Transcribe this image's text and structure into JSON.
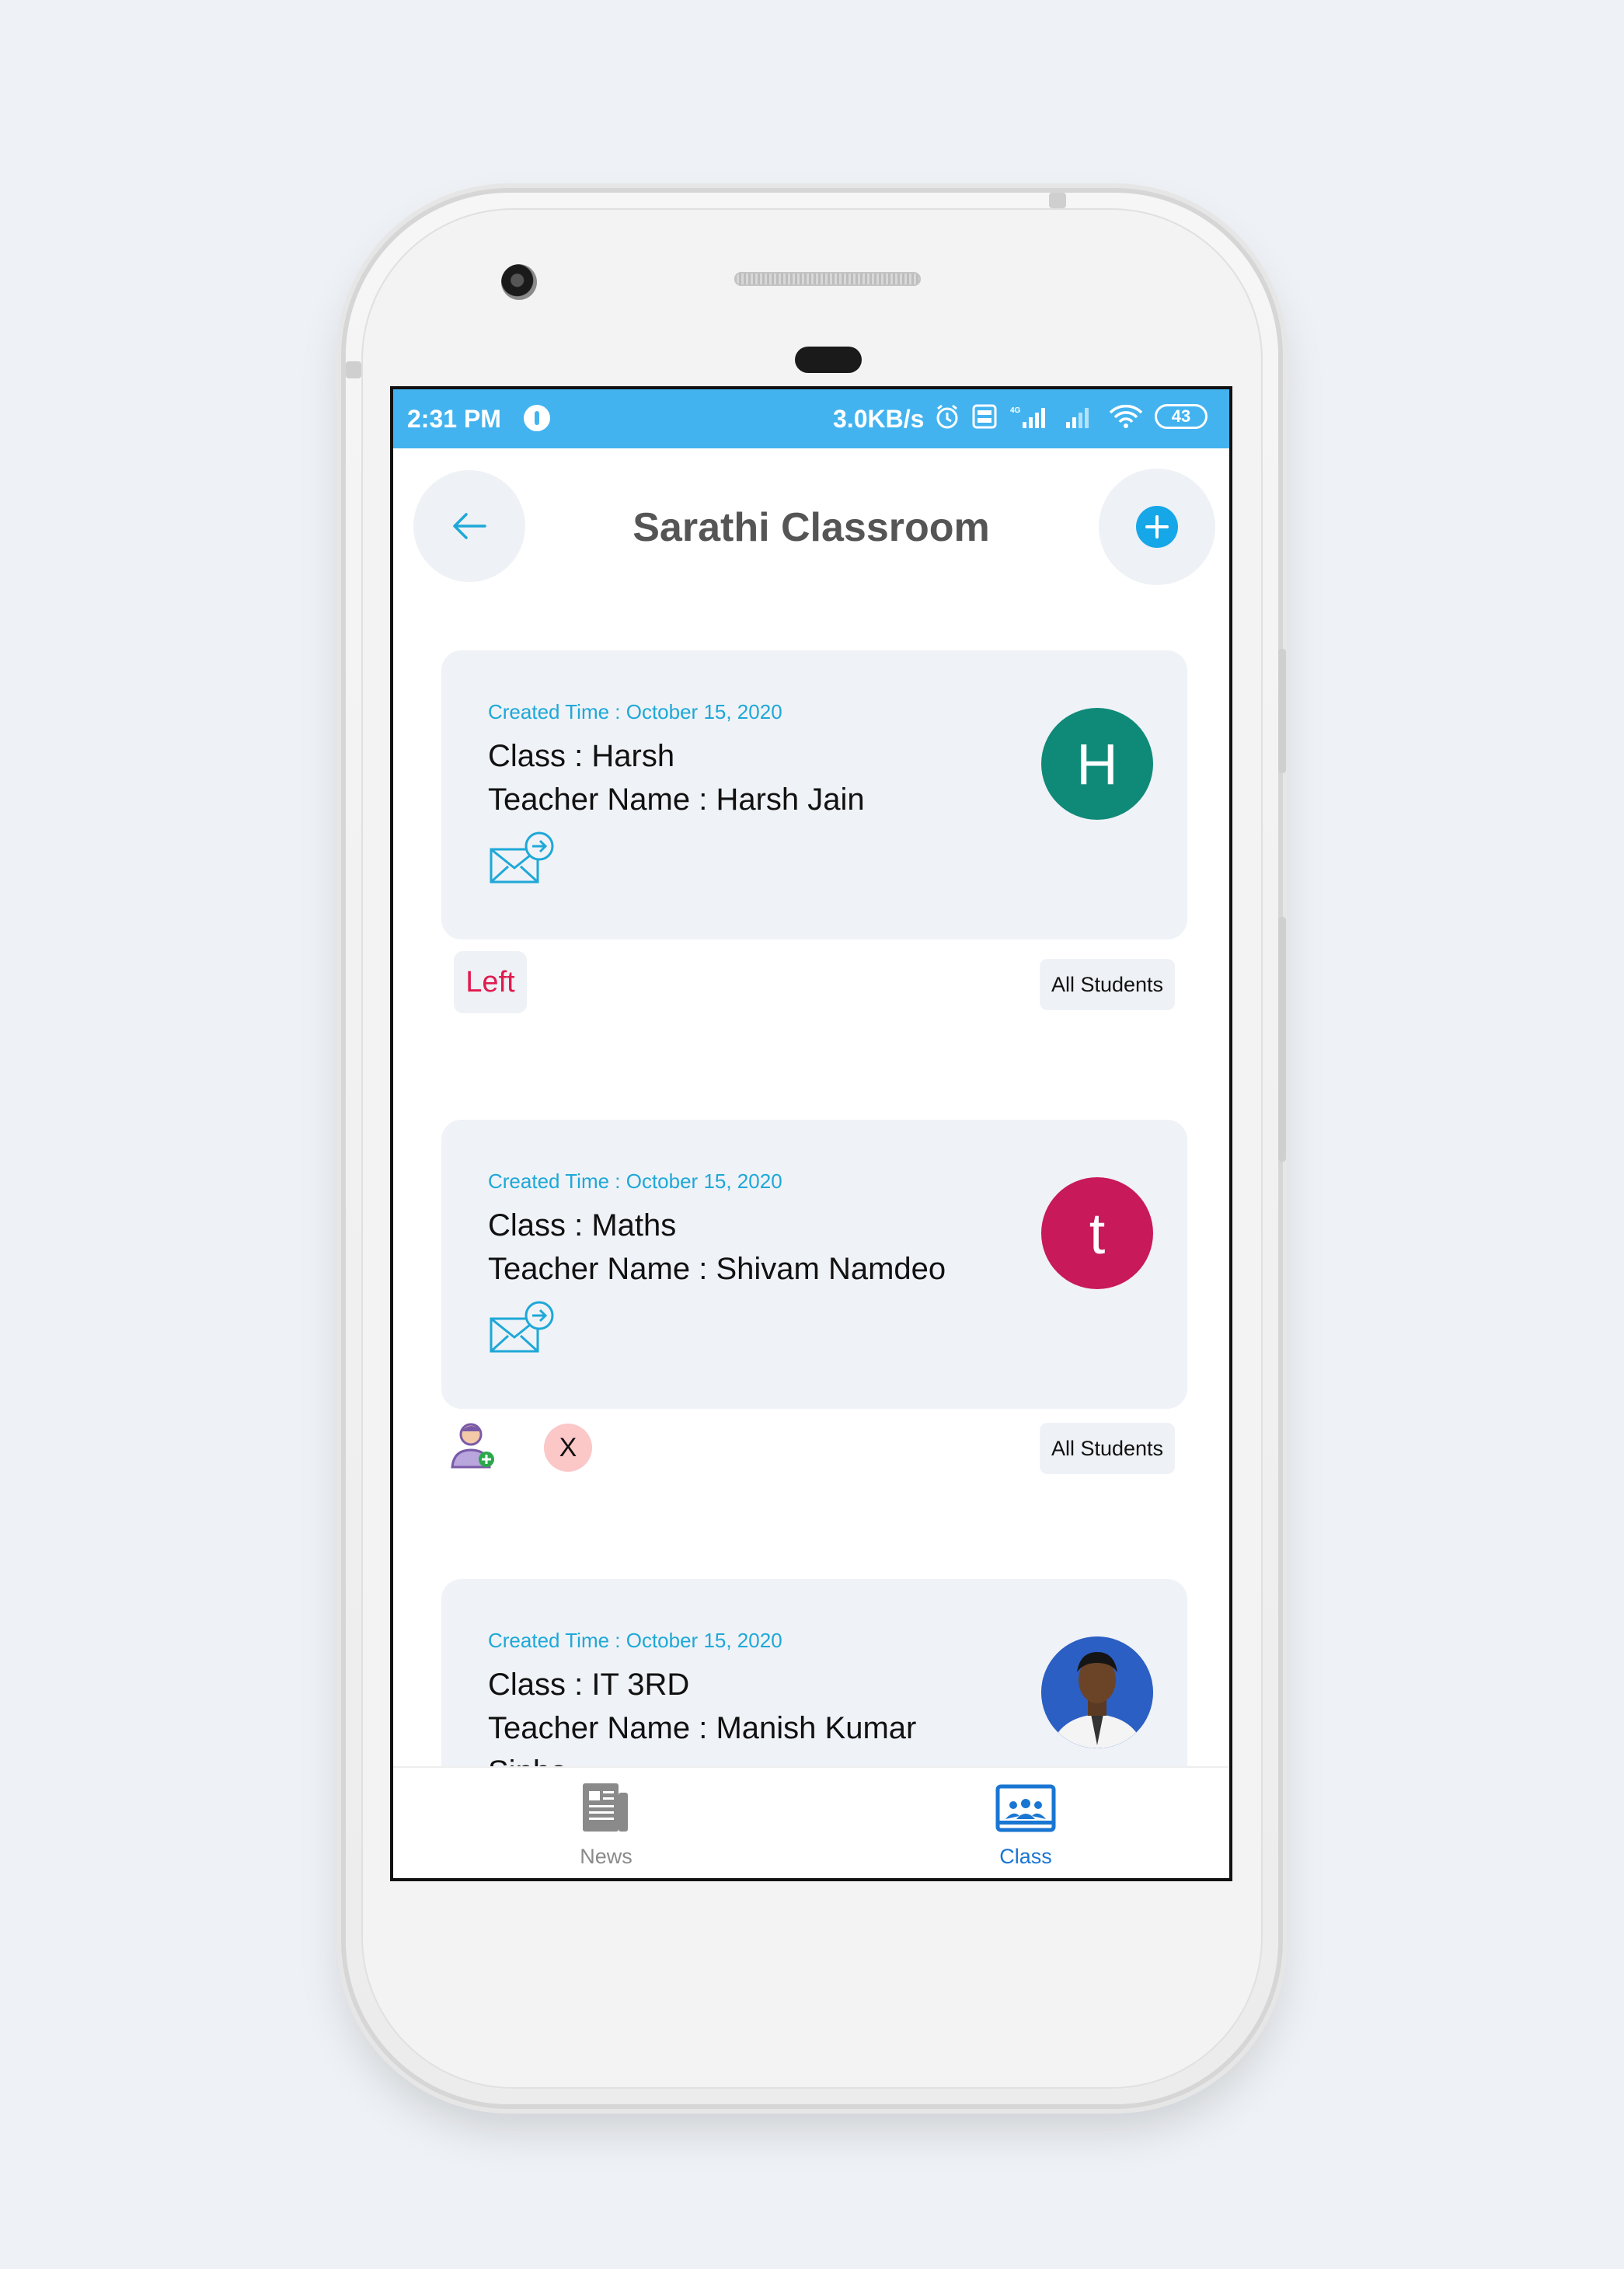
{
  "status_bar": {
    "time": "2:31 PM",
    "speed": "3.0KB/s",
    "battery": "43"
  },
  "header": {
    "title": "Sarathi Classroom"
  },
  "classes": [
    {
      "created": "Created Time : October 15, 2020",
      "class_line": "Class : Harsh",
      "teacher_line": "Teacher Name : Harsh Jain",
      "avatar_letter": "H",
      "avatar_color": "#0f8a78",
      "status_label": "Left",
      "all_students_label": "All Students"
    },
    {
      "created": "Created Time : October 15, 2020",
      "class_line": "Class : Maths",
      "teacher_line": "Teacher Name : Shivam Namdeo",
      "avatar_letter": "t",
      "avatar_color": "#c8195a",
      "remove_label": "X",
      "all_students_label": "All Students"
    },
    {
      "created": "Created Time : October 15, 2020",
      "class_line": "Class : IT 3RD",
      "teacher_line": "Teacher Name : Manish Kumar",
      "teacher_line_cont": "Sinha",
      "avatar_color": "#2c5fc4"
    }
  ],
  "bottom_nav": {
    "items": [
      {
        "label": "News",
        "icon": "newspaper-icon",
        "active": false
      },
      {
        "label": "Class",
        "icon": "classroom-icon",
        "active": true
      }
    ]
  },
  "colors": {
    "accent": "#1ea8d8",
    "status_bar": "#43b3f0",
    "nav_active": "#1976d2",
    "nav_inactive": "#8a8a8a"
  }
}
